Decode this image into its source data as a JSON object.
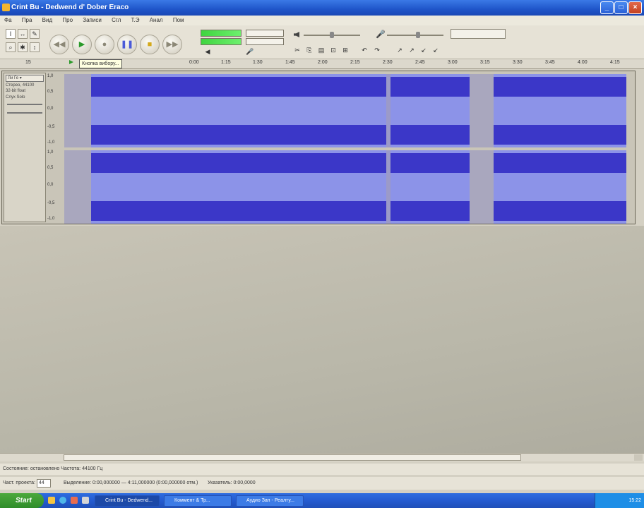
{
  "window": {
    "title": "Crint Bu - Dedwend d' Dober Eraco",
    "buttons": [
      "_",
      "□",
      "×"
    ]
  },
  "menu": [
    "Фа",
    "Пра",
    "Вид",
    "Про",
    "Записи",
    "Сгл",
    "Т.Э",
    "Анал",
    "Пом"
  ],
  "toolbar": {
    "tools": [
      "I",
      "↔",
      "✎",
      "⌕",
      "✱",
      "↕"
    ],
    "transport": [
      "◀◀",
      "▶",
      "●",
      "❚❚",
      "■",
      "▶▶"
    ],
    "edit_icons": [
      "✂",
      "⎘",
      "▤",
      "⊡",
      "⊞",
      "↶",
      "↷",
      "↗",
      "↗",
      "↙",
      "↙"
    ],
    "input_select": ""
  },
  "ruler": {
    "start": "15",
    "tooltip": "Кнопка вибору...",
    "ticks": [
      "0:00",
      "1:15",
      "1:30",
      "1:45",
      "2:00",
      "2:15",
      "2:30",
      "2:45",
      "3:00",
      "3:15",
      "3:30",
      "3:45",
      "4:00",
      "4:15"
    ]
  },
  "track": {
    "name": "Ли Ге ▾",
    "info": [
      "Стерео, 44100",
      "32-bit float",
      "Слух  Solo"
    ],
    "scale_top": [
      "1,0",
      "0,5",
      "0,0",
      "-0,5",
      "-1,0"
    ],
    "scale_bottom": [
      "1,0",
      "0,5",
      "0,0",
      "-0,5",
      "-1,0"
    ]
  },
  "status": {
    "line1": "Состояние: остановлено   Частота: 44100 Гц",
    "rate_label": "Част. проекта:",
    "rate_value": "44",
    "selection": "Выделение: 0:00,000000 — 4:11,000000 (0:00,000000 отм.)",
    "position": "Указатель: 0:00,0000"
  },
  "taskbar": {
    "start": "Start",
    "tasks": [
      "Crint Bu - Dedwend...",
      "Коммент & Тр...",
      "Аудио Зап - Реалту..."
    ],
    "clock": "15:22"
  }
}
